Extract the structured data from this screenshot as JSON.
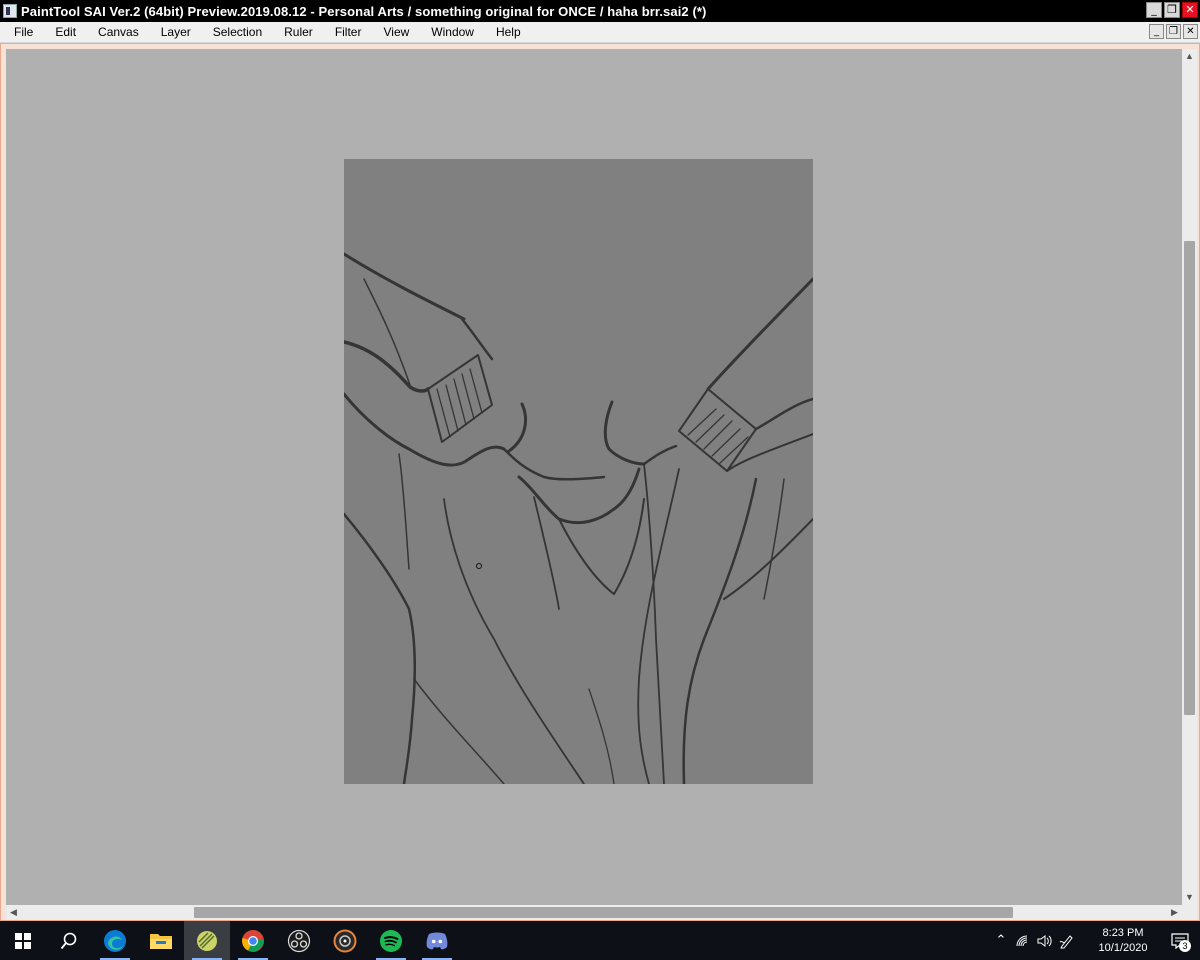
{
  "window": {
    "title": "PaintTool SAI Ver.2 (64bit) Preview.2019.08.12 - Personal Arts / something original for ONCE / haha brr.sai2 (*)",
    "controls": {
      "minimize": "_",
      "restore": "❐",
      "close": "✕"
    }
  },
  "menu": {
    "items": [
      {
        "label": "File"
      },
      {
        "label": "Edit"
      },
      {
        "label": "Canvas"
      },
      {
        "label": "Layer"
      },
      {
        "label": "Selection"
      },
      {
        "label": "Ruler"
      },
      {
        "label": "Filter"
      },
      {
        "label": "View"
      },
      {
        "label": "Window"
      },
      {
        "label": "Help"
      }
    ]
  },
  "canvas": {
    "area_color": "#b0b0b0",
    "paper_color": "#808080",
    "line_color": "#333333",
    "vertical_scroll_position": 0.22,
    "horizontal_scroll_position": 0.16
  },
  "taskbar": {
    "apps": [
      {
        "name": "start-icon"
      },
      {
        "name": "search-icon"
      },
      {
        "name": "edge-icon"
      },
      {
        "name": "file-explorer-icon"
      },
      {
        "name": "painttool-sai-icon",
        "active": true
      },
      {
        "name": "chrome-icon"
      },
      {
        "name": "obs-icon"
      },
      {
        "name": "media-player-icon"
      },
      {
        "name": "spotify-icon"
      },
      {
        "name": "discord-icon"
      }
    ],
    "tray": {
      "time": "8:23 PM",
      "date": "10/1/2020",
      "notification_count": "3"
    }
  }
}
